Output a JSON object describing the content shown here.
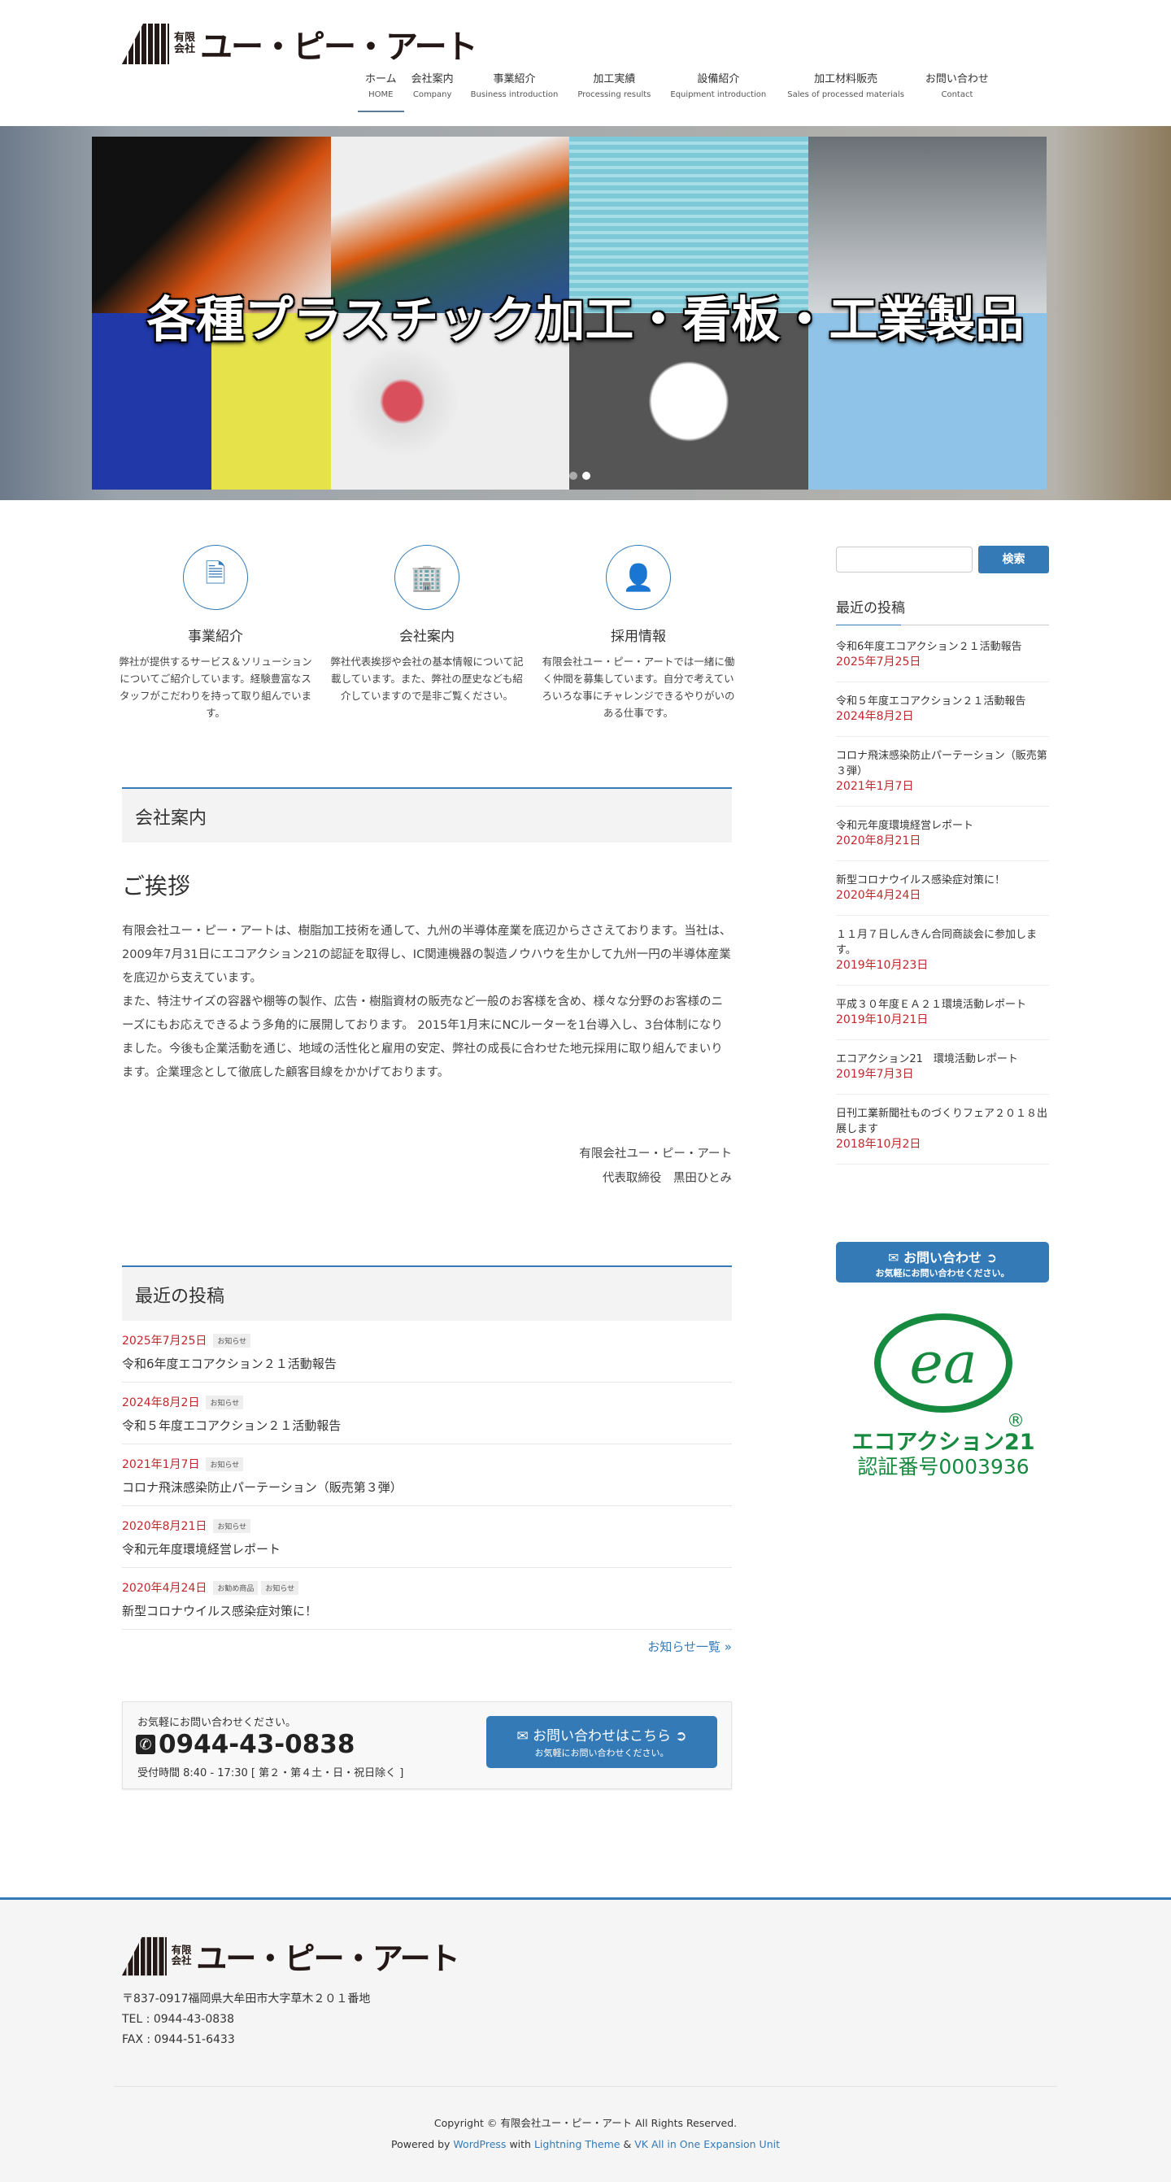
{
  "header": {
    "logo": {
      "small1": "有限",
      "small2": "会社",
      "name": "ユー・ピー・アート"
    },
    "nav": [
      {
        "ja": "ホーム",
        "en": "HOME"
      },
      {
        "ja": "会社案内",
        "en": "Company"
      },
      {
        "ja": "事業紹介",
        "en": "Business introduction"
      },
      {
        "ja": "加工実績",
        "en": "Processing results"
      },
      {
        "ja": "設備紹介",
        "en": "Equipment introduction"
      },
      {
        "ja": "加工材料販売",
        "en": "Sales of processed materials"
      },
      {
        "ja": "お問い合わせ",
        "en": "Contact"
      }
    ]
  },
  "hero": {
    "caption": "各種プラスチック加工・看板・工業製品",
    "slides": 2,
    "active_slide": 2
  },
  "features": [
    {
      "icon": "document-icon",
      "title": "事業紹介",
      "desc": "弊社が提供するサービス＆ソリューションについてご紹介しています。経験豊富なスタッフがこだわりを持って取り組んでいます。"
    },
    {
      "icon": "building-icon",
      "title": "会社案内",
      "desc": "弊社代表挨拶や会社の基本情報について記載しています。また、弊社の歴史なども紹介していますので是非ご覧ください。"
    },
    {
      "icon": "person-icon",
      "title": "採用情報",
      "desc": "有限会社ユー・ピー・アートでは一緒に働く仲間を募集しています。自分で考えていろいろな事にチャレンジできるやりがいのある仕事です。"
    }
  ],
  "company": {
    "heading": "会社案内",
    "greeting_title": "ご挨拶",
    "para1": "有限会社ユー・ピー・アートは、樹脂加工技術を通して、九州の半導体産業を底辺からささえております。当社は、2009年7月31日にエコアクション21の認証を取得し、IC関連機器の製造ノウハウを生かして九州一円の半導体産業を底辺から支えています。",
    "para2": "また、特注サイズの容器や棚等の製作、広告・樹脂資材の販売など一般のお客様を含め、様々な分野のお客様のニーズにもお応えできるよう多角的に展開しております。 2015年1月末にNCルーターを1台導入し、3台体制になりました。今後も企業活動を通じ、地域の活性化と雇用の安定、弊社の成長に合わせた地元採用に取り組んでまいります。企業理念として徹底した顧客目線をかかげております。",
    "sign_company": "有限会社ユー・ピー・アート",
    "sign_person": "代表取締役　黒田ひとみ"
  },
  "recent": {
    "heading": "最近の投稿",
    "items": [
      {
        "date": "2025年7月25日",
        "tags": [
          "お知らせ"
        ],
        "title": "令和6年度エコアクション２１活動報告"
      },
      {
        "date": "2024年8月2日",
        "tags": [
          "お知らせ"
        ],
        "title": "令和５年度エコアクション２１活動報告"
      },
      {
        "date": "2021年1月7日",
        "tags": [
          "お知らせ"
        ],
        "title": "コロナ飛沫感染防止パーテーション（販売第３弾）"
      },
      {
        "date": "2020年8月21日",
        "tags": [
          "お知らせ"
        ],
        "title": "令和元年度環境経営レポート"
      },
      {
        "date": "2020年4月24日",
        "tags": [
          "お勧め商品",
          "お知らせ"
        ],
        "title": "新型コロナウイルス感染症対策に！"
      }
    ],
    "more": "お知らせ一覧 »"
  },
  "contact_box": {
    "lead": "お気軽にお問い合わせください。",
    "phone": "0944-43-0838",
    "hours": "受付時間 8:40 - 17:30 [ 第２・第４土・日・祝日除く ]",
    "button": "お問い合わせはこちら",
    "button_sub": "お気軽にお問い合わせください。"
  },
  "sidebar": {
    "search_placeholder": "",
    "search_button": "検索",
    "recent_heading": "最近の投稿",
    "items": [
      {
        "title": "令和6年度エコアクション２１活動報告",
        "date": "2025年7月25日"
      },
      {
        "title": "令和５年度エコアクション２１活動報告",
        "date": "2024年8月2日"
      },
      {
        "title": "コロナ飛沫感染防止パーテーション（販売第３弾）",
        "date": "2021年1月7日"
      },
      {
        "title": "令和元年度環境経営レポート",
        "date": "2020年8月21日"
      },
      {
        "title": "新型コロナウイルス感染症対策に！",
        "date": "2020年4月24日"
      },
      {
        "title": "１１月７日しんきん合同商談会に参加します。",
        "date": "2019年10月23日"
      },
      {
        "title": "平成３０年度ＥＡ２１環境活動レポート",
        "date": "2019年10月21日"
      },
      {
        "title": "エコアクション21　環境活動レポート",
        "date": "2019年7月3日"
      },
      {
        "title": "日刊工業新聞社ものづくりフェア２０１８出展します",
        "date": "2018年10月2日"
      }
    ],
    "contact_button": "お問い合わせ",
    "contact_sub": "お気軽にお問い合わせください。",
    "eco": {
      "name": "エコアクション21",
      "cert": "認証番号0003936",
      "mark": "ea",
      "reg": "®"
    }
  },
  "footer": {
    "address": "〒837-0917福岡県大牟田市大字草木２０１番地",
    "tel": "TEL : 0944-43-0838",
    "fax": "FAX : 0944-51-6433",
    "copyright": "Copyright © 有限会社ユー・ピー・アート All Rights Reserved.",
    "powered": "Powered by",
    "wp": "WordPress",
    "with": "with",
    "lightning": "Lightning Theme",
    "amp": "&",
    "vk": "VK All in One Expansion Unit"
  },
  "colors": {
    "accent": "#337ab7",
    "date": "#c1272d",
    "eco_green": "#168a3e"
  }
}
